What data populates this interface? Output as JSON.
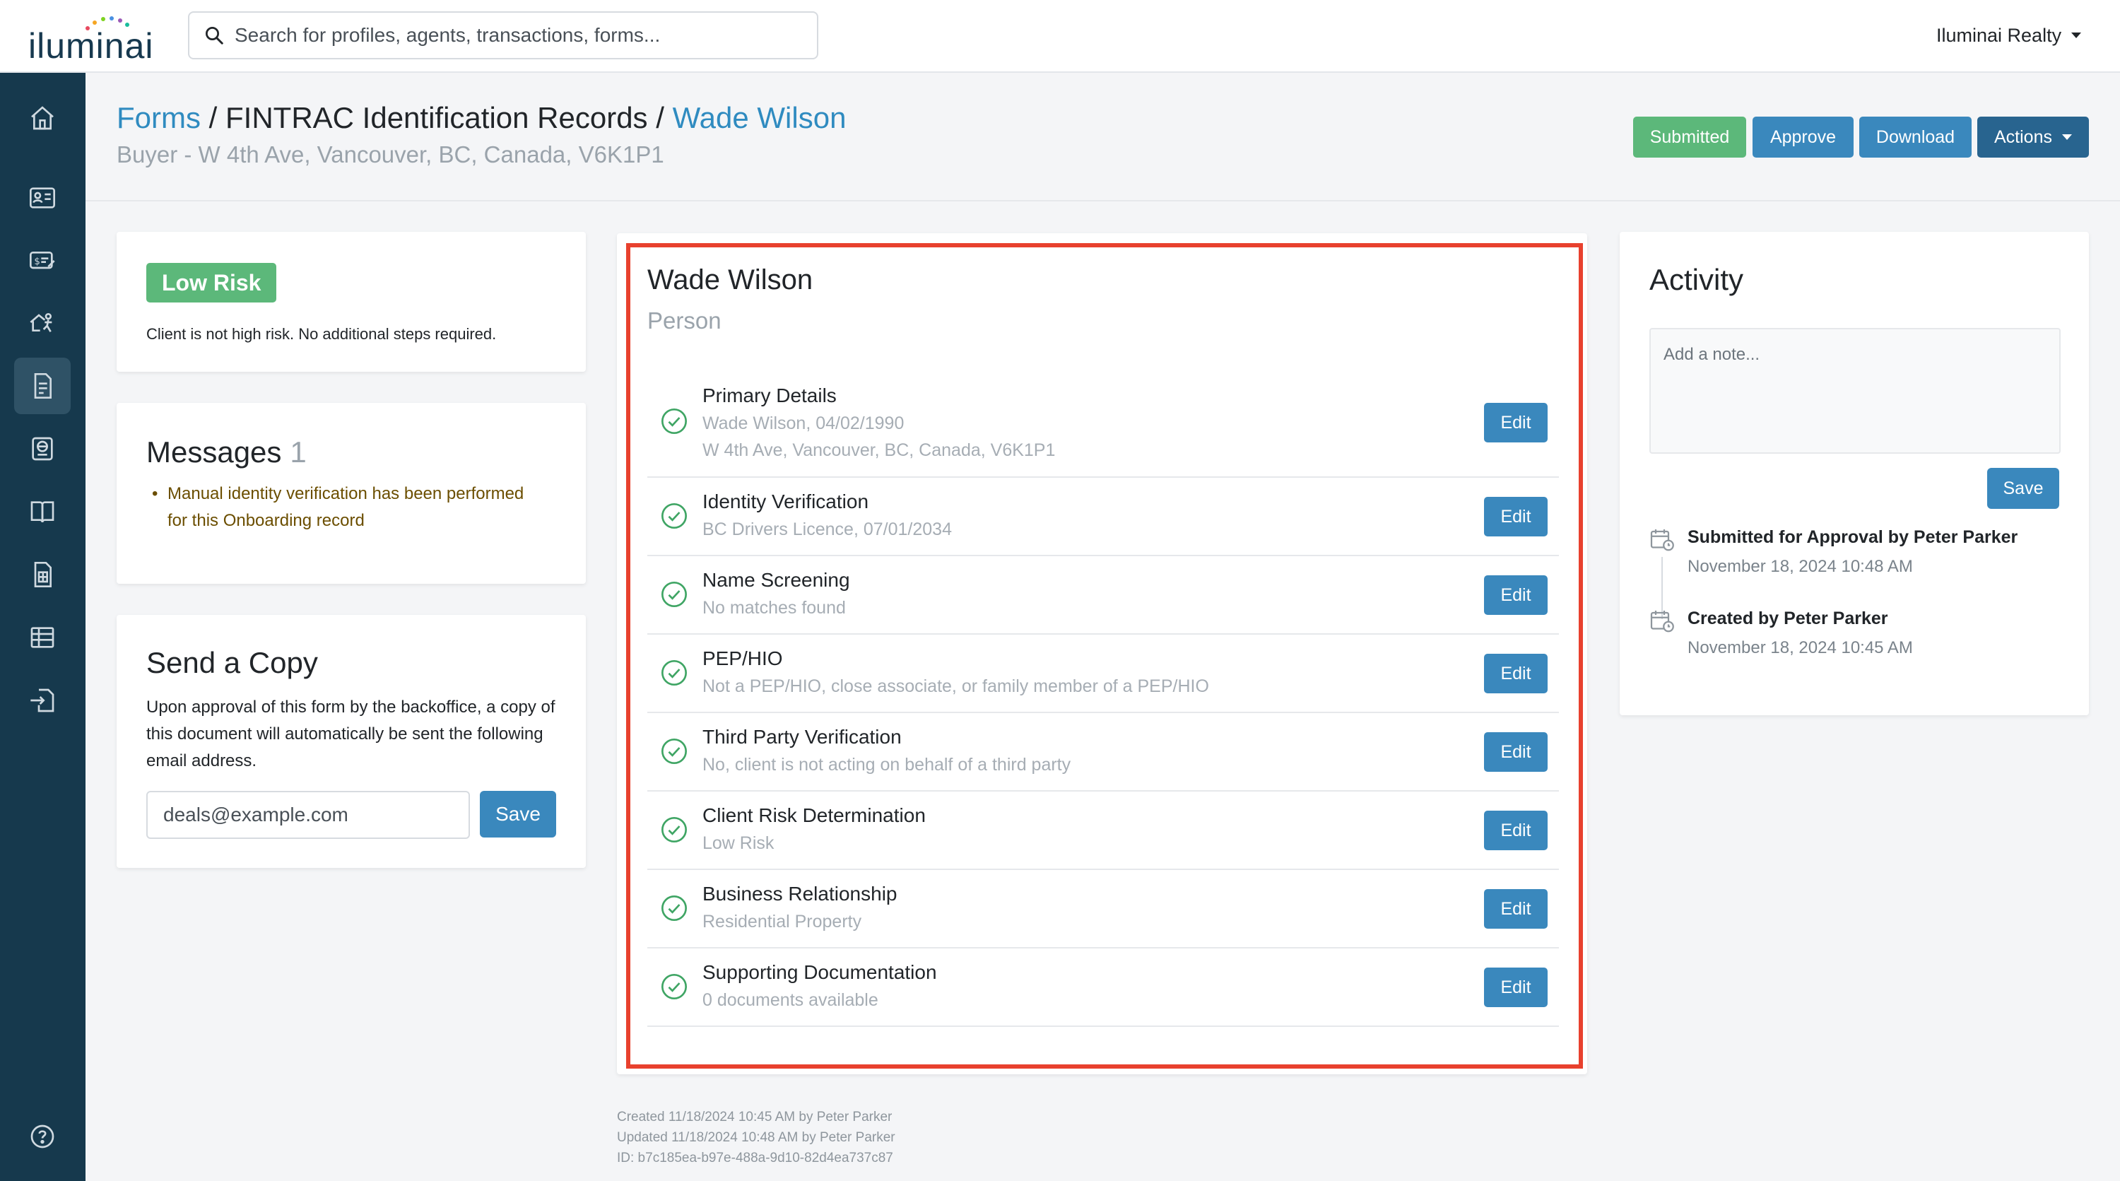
{
  "app": {
    "brand": "iluminai",
    "org_name": "Iluminai Realty",
    "search_placeholder": "Search for profiles, agents, transactions, forms..."
  },
  "sidebar": {
    "items": [
      {
        "name": "home-icon"
      },
      {
        "name": "profile-card-icon"
      },
      {
        "name": "transactions-icon"
      },
      {
        "name": "property-agent-icon"
      },
      {
        "name": "forms-icon",
        "active": true
      },
      {
        "name": "compliance-icon"
      },
      {
        "name": "library-icon"
      },
      {
        "name": "reports-icon"
      },
      {
        "name": "table-icon"
      },
      {
        "name": "import-icon"
      },
      {
        "name": "help-icon"
      }
    ]
  },
  "header": {
    "breadcrumb": {
      "root": "Forms",
      "sep": "/",
      "section": "FINTRAC Identification Records",
      "current": "Wade Wilson"
    },
    "subtitle": "Buyer - W 4th Ave, Vancouver, BC, Canada, V6K1P1",
    "buttons": {
      "status": "Submitted",
      "approve": "Approve",
      "download": "Download",
      "actions": "Actions"
    }
  },
  "risk": {
    "badge": "Low Risk",
    "text": "Client is not high risk. No additional steps required."
  },
  "messages": {
    "title": "Messages",
    "count": "1",
    "items": [
      "Manual identity verification has been performed for this Onboarding record"
    ]
  },
  "send_copy": {
    "title": "Send a Copy",
    "text": "Upon approval of this form by the backoffice, a copy of this document will automatically be sent the following email address.",
    "email_value": "deals@example.com",
    "save_label": "Save"
  },
  "record": {
    "name": "Wade Wilson",
    "type": "Person",
    "edit_label": "Edit",
    "sections": [
      {
        "title": "Primary Details",
        "lines": [
          "Wade Wilson, 04/02/1990",
          "W 4th Ave, Vancouver, BC, Canada, V6K1P1"
        ]
      },
      {
        "title": "Identity Verification",
        "lines": [
          "BC Drivers Licence, 07/01/2034"
        ]
      },
      {
        "title": "Name Screening",
        "lines": [
          "No matches found"
        ]
      },
      {
        "title": "PEP/HIO",
        "lines": [
          "Not a PEP/HIO, close associate, or family member of a PEP/HIO"
        ]
      },
      {
        "title": "Third Party Verification",
        "lines": [
          "No, client is not acting on behalf of a third party"
        ]
      },
      {
        "title": "Client Risk Determination",
        "lines": [
          "Low Risk"
        ]
      },
      {
        "title": "Business Relationship",
        "lines": [
          "Residential Property"
        ]
      },
      {
        "title": "Supporting Documentation",
        "lines": [
          "0 documents available"
        ]
      }
    ]
  },
  "meta": {
    "created": "Created 11/18/2024 10:45 AM by Peter Parker",
    "updated": "Updated 11/18/2024 10:48 AM by Peter Parker",
    "id": "ID: b7c185ea-b97e-488a-9d10-82d4ea737c87"
  },
  "activity": {
    "title": "Activity",
    "note_placeholder": "Add a note...",
    "save_label": "Save",
    "entries": [
      {
        "title": "Submitted for Approval by Peter Parker",
        "time": "November 18, 2024 10:48 AM"
      },
      {
        "title": "Created by Peter Parker",
        "time": "November 18, 2024 10:45 AM"
      }
    ]
  },
  "colors": {
    "sidebar": "#16394d",
    "link": "#2f8bc0",
    "primary_button": "#3a88bd",
    "success": "#5cb87a",
    "dark_button": "#28648f",
    "highlight": "#e8412e"
  }
}
